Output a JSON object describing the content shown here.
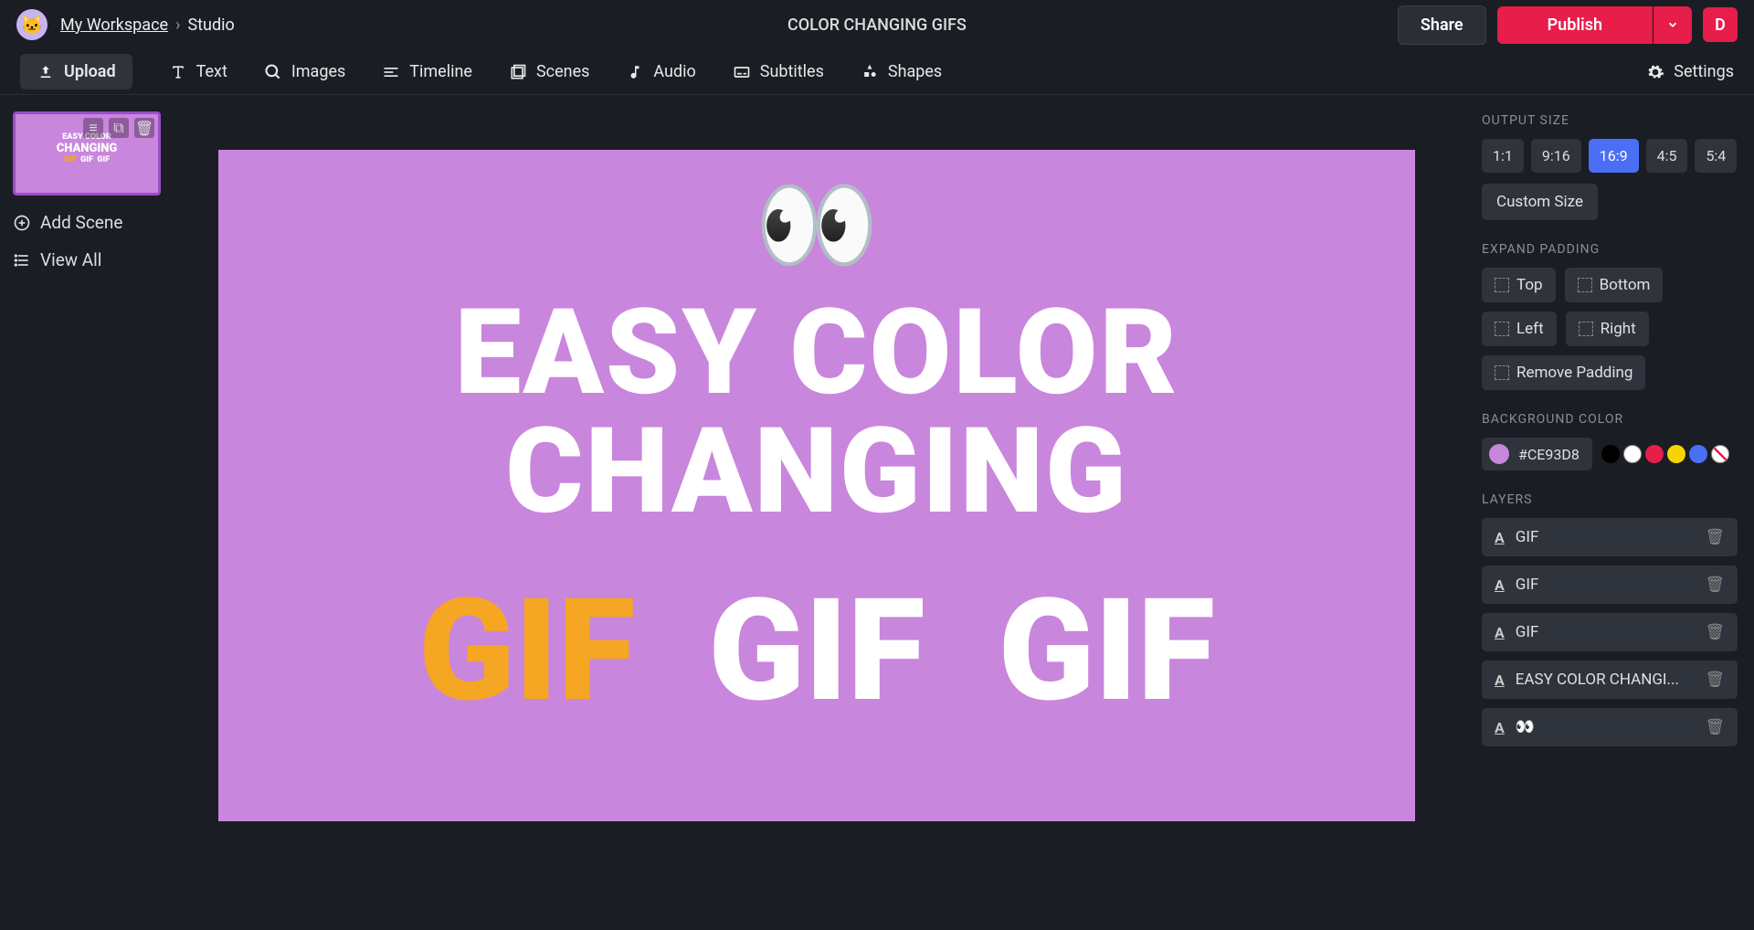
{
  "header": {
    "workspace": "My Workspace",
    "section": "Studio",
    "title": "COLOR CHANGING GIFS",
    "share": "Share",
    "publish": "Publish",
    "user_initial": "D"
  },
  "toolbar": {
    "upload": "Upload",
    "text": "Text",
    "images": "Images",
    "timeline": "Timeline",
    "scenes": "Scenes",
    "audio": "Audio",
    "subtitles": "Subtitles",
    "shapes": "Shapes",
    "settings": "Settings"
  },
  "scenes": {
    "add": "Add Scene",
    "view_all": "View All",
    "thumb_line1": "EASY COLOR",
    "thumb_line2": "CHANGING",
    "thumb_g": "GIF"
  },
  "canvas": {
    "eyes": "👀",
    "line1": "EASY COLOR",
    "line2": "CHANGING",
    "gif1": "GIF",
    "gif2": "GIF",
    "gif3": "GIF",
    "bg_color": "#CE93D8"
  },
  "panel": {
    "output_size": "OUTPUT SIZE",
    "ratios": [
      "1:1",
      "9:16",
      "16:9",
      "4:5",
      "5:4"
    ],
    "ratio_active": "16:9",
    "custom_size": "Custom Size",
    "expand_padding": "EXPAND PADDING",
    "pad_top": "Top",
    "pad_bottom": "Bottom",
    "pad_left": "Left",
    "pad_right": "Right",
    "pad_remove": "Remove Padding",
    "bg_label": "BACKGROUND COLOR",
    "bg_hex": "#CE93D8",
    "swatches": [
      "#000000",
      "#ffffff",
      "#e71d4a",
      "#f5d400",
      "#4a6ff5",
      "none"
    ],
    "layers_label": "LAYERS",
    "layers": [
      {
        "label": "GIF"
      },
      {
        "label": "GIF"
      },
      {
        "label": "GIF"
      },
      {
        "label": "EASY COLOR CHANGI..."
      },
      {
        "label": "👀"
      }
    ]
  }
}
